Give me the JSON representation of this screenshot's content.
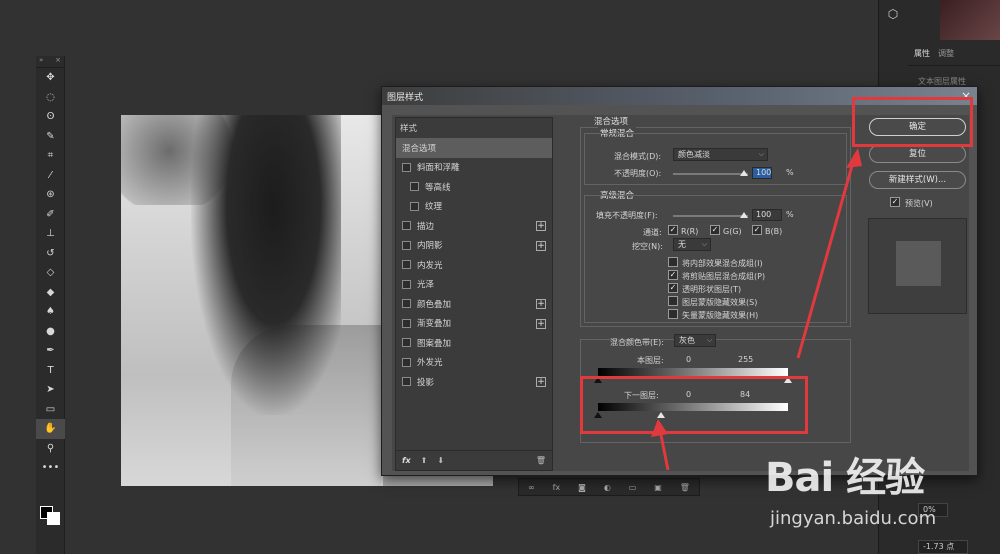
{
  "dialog": {
    "title": "图层样式",
    "close": "×",
    "styles_header": "样式",
    "style_items": [
      {
        "label": "混合选项",
        "checkbox": false,
        "plus": false,
        "selected": true,
        "indent": false
      },
      {
        "label": "斜面和浮雕",
        "checkbox": true,
        "plus": false,
        "selected": false,
        "indent": false
      },
      {
        "label": "等高线",
        "checkbox": true,
        "plus": false,
        "selected": false,
        "indent": true
      },
      {
        "label": "纹理",
        "checkbox": true,
        "plus": false,
        "selected": false,
        "indent": true
      },
      {
        "label": "描边",
        "checkbox": true,
        "plus": true,
        "selected": false,
        "indent": false
      },
      {
        "label": "内阴影",
        "checkbox": true,
        "plus": true,
        "selected": false,
        "indent": false
      },
      {
        "label": "内发光",
        "checkbox": true,
        "plus": false,
        "selected": false,
        "indent": false
      },
      {
        "label": "光泽",
        "checkbox": true,
        "plus": false,
        "selected": false,
        "indent": false
      },
      {
        "label": "颜色叠加",
        "checkbox": true,
        "plus": true,
        "selected": false,
        "indent": false
      },
      {
        "label": "渐变叠加",
        "checkbox": true,
        "plus": true,
        "selected": false,
        "indent": false
      },
      {
        "label": "图案叠加",
        "checkbox": true,
        "plus": false,
        "selected": false,
        "indent": false
      },
      {
        "label": "外发光",
        "checkbox": true,
        "plus": false,
        "selected": false,
        "indent": false
      },
      {
        "label": "投影",
        "checkbox": true,
        "plus": true,
        "selected": false,
        "indent": false
      }
    ],
    "footer_fx": "fx",
    "blend_options": "混合选项",
    "general_blending": "常规混合",
    "blend_mode_label": "混合模式(D):",
    "blend_mode_value": "颜色减淡",
    "opacity_label": "不透明度(O):",
    "opacity_value": "100",
    "opacity_pct": 100,
    "pct": "%",
    "advanced_blending": "高级混合",
    "fill_opacity_label": "填充不透明度(F):",
    "fill_opacity_value": "100",
    "fill_pct": 100,
    "channels_label": "通道:",
    "channel_r": "R(R)",
    "channel_g": "G(G)",
    "channel_b": "B(B)",
    "knockout_label": "挖空(N):",
    "knockout_value": "无",
    "opt1": "将内部效果混合成组(I)",
    "opt2": "将剪贴图层混合成组(P)",
    "opt3": "透明形状图层(T)",
    "opt4": "图层蒙版隐藏效果(S)",
    "opt5": "矢量蒙版隐藏效果(H)",
    "opt1_checked": false,
    "opt2_checked": true,
    "opt3_checked": true,
    "opt4_checked": false,
    "opt5_checked": false,
    "blend_if_label": "混合颜色带(E):",
    "blend_if_value": "灰色",
    "this_layer_label": "本图层:",
    "this_layer_low": "0",
    "this_layer_high": "255",
    "underlying_label": "下一图层:",
    "underlying_low": "0",
    "underlying_high": "84",
    "underlying_high_frac": 0.33
  },
  "buttons": {
    "ok": "确定",
    "reset": "复位",
    "new_style": "新建样式(W)...",
    "preview": "预览(V)"
  },
  "right_dock": {
    "tab1": "属性",
    "tab2": "调整",
    "sub": "文本图层属性",
    "field1": "0%",
    "field2": "-1.73 点"
  },
  "watermark": {
    "logo": "Bai 经验",
    "url": "jingyan.baidu.com"
  },
  "colors": {
    "highlight": "#e0393e",
    "selection": "#2b5e9e"
  }
}
